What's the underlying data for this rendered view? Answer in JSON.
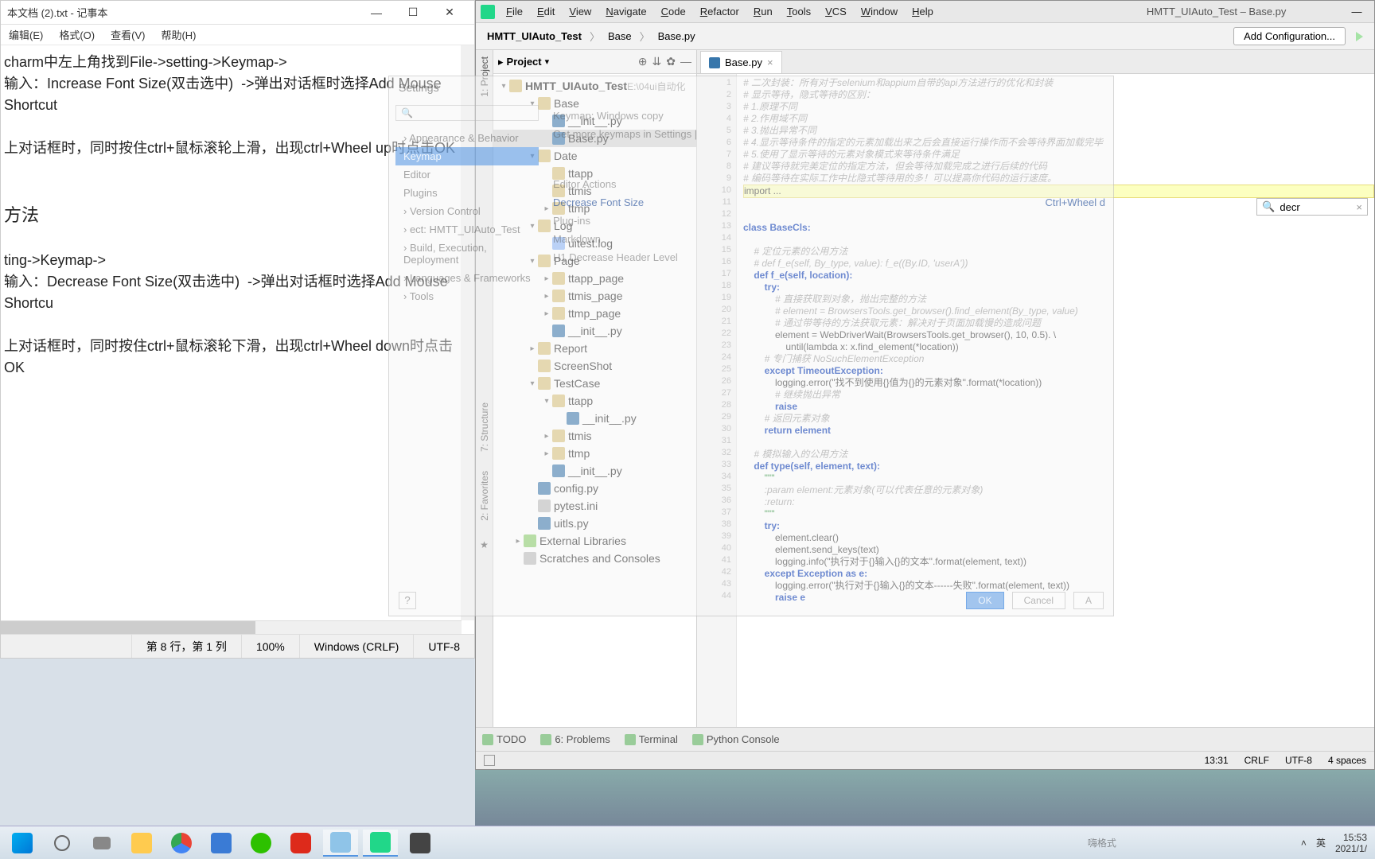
{
  "notepad": {
    "title": "本文档 (2).txt - 记事本",
    "menu": [
      "编辑(E)",
      "格式(O)",
      "查看(V)",
      "帮助(H)"
    ],
    "lines": [
      "charm中左上角找到File->setting->Keymap->",
      "输入：Increase Font Size(双击选中)  ->弹出对话框时选择Add Mouse Shortcut",
      "",
      "上对话框时，同时按住ctrl+鼠标滚轮上滑，出现ctrl+Wheel up时点击OK",
      "",
      "",
      "方法",
      "",
      "ting->Keymap->",
      "输入：Decrease Font Size(双击选中)  ->弹出对话框时选择Add Mouse Shortcu",
      "",
      "上对话框时，同时按住ctrl+鼠标滚轮下滑，出现ctrl+Wheel down时点击OK"
    ],
    "status": {
      "pos": "第 8 行，第 1 列",
      "zoom": "100%",
      "eol": "Windows (CRLF)",
      "enc": "UTF-8"
    }
  },
  "pycharm": {
    "title": "HMTT_UIAuto_Test – Base.py",
    "menu": [
      "File",
      "Edit",
      "View",
      "Navigate",
      "Code",
      "Refactor",
      "Run",
      "Tools",
      "VCS",
      "Window",
      "Help"
    ],
    "breadcrumb": [
      "HMTT_UIAuto_Test",
      "Base",
      "Base.py"
    ],
    "add_config": "Add Configuration...",
    "project": {
      "title": "Project",
      "root": "HMTT_UIAuto_Test",
      "root_path": "E:\\04ui自动化",
      "tree": [
        {
          "l": 1,
          "t": "v",
          "i": "folder",
          "n": "Base"
        },
        {
          "l": 2,
          "t": "",
          "i": "py",
          "n": "__init__.py"
        },
        {
          "l": 2,
          "t": "",
          "i": "py",
          "n": "Base.py",
          "sel": true
        },
        {
          "l": 1,
          "t": "v",
          "i": "folder",
          "n": "Date"
        },
        {
          "l": 2,
          "t": "",
          "i": "folder",
          "n": "ttapp"
        },
        {
          "l": 2,
          "t": "",
          "i": "folder",
          "n": "ttmis"
        },
        {
          "l": 2,
          "t": ">",
          "i": "folder",
          "n": "ttmp"
        },
        {
          "l": 1,
          "t": "v",
          "i": "folder",
          "n": "Log"
        },
        {
          "l": 2,
          "t": "",
          "i": "log",
          "n": "uitest.log"
        },
        {
          "l": 1,
          "t": "v",
          "i": "folder",
          "n": "Page"
        },
        {
          "l": 2,
          "t": ">",
          "i": "folder",
          "n": "ttapp_page"
        },
        {
          "l": 2,
          "t": ">",
          "i": "folder",
          "n": "ttmis_page"
        },
        {
          "l": 2,
          "t": ">",
          "i": "folder",
          "n": "ttmp_page"
        },
        {
          "l": 2,
          "t": "",
          "i": "py",
          "n": "__init__.py"
        },
        {
          "l": 1,
          "t": ">",
          "i": "folder",
          "n": "Report"
        },
        {
          "l": 1,
          "t": "",
          "i": "folder",
          "n": "ScreenShot"
        },
        {
          "l": 1,
          "t": "v",
          "i": "folder",
          "n": "TestCase"
        },
        {
          "l": 2,
          "t": "v",
          "i": "folder",
          "n": "ttapp"
        },
        {
          "l": 3,
          "t": "",
          "i": "py",
          "n": "__init__.py"
        },
        {
          "l": 2,
          "t": ">",
          "i": "folder",
          "n": "ttmis"
        },
        {
          "l": 2,
          "t": ">",
          "i": "folder",
          "n": "ttmp"
        },
        {
          "l": 2,
          "t": "",
          "i": "py",
          "n": "__init__.py"
        },
        {
          "l": 1,
          "t": "",
          "i": "py",
          "n": "config.py"
        },
        {
          "l": 1,
          "t": "",
          "i": "file",
          "n": "pytest.ini"
        },
        {
          "l": 1,
          "t": "",
          "i": "py",
          "n": "uitls.py"
        },
        {
          "l": 0,
          "t": ">",
          "i": "lib",
          "n": "External Libraries"
        },
        {
          "l": 0,
          "t": "",
          "i": "file",
          "n": "Scratches and Consoles"
        }
      ]
    },
    "tab": "Base.py",
    "search": "decr",
    "status": {
      "pos": "13:31",
      "eol": "CRLF",
      "enc": "UTF-8",
      "indent": "4 spaces"
    },
    "tool_windows": [
      "TODO",
      "6: Problems",
      "Terminal",
      "Python Console"
    ],
    "side_tools": [
      "1: Project",
      "7: Structure",
      "2: Favorites"
    ],
    "settings_ghost": {
      "title": "Settings",
      "keymap_label": "Keymap:",
      "keymap_value": "Windows copy",
      "hint": "Get more keymaps in Settings |",
      "side": [
        "Appearance & Behavior",
        "Keymap",
        "Editor",
        "Plugins",
        "Version Control",
        "ect: HMTT_UIAuto_Test",
        "Build, Execution, Deployment",
        "Languages & Frameworks",
        "Tools"
      ],
      "categories": [
        "Editor Actions",
        "Decrease Font Size",
        "Plug-ins",
        "Markdown",
        "H1 Decrease Header Level"
      ],
      "shortcut": "Ctrl+Wheel d",
      "buttons": [
        "OK",
        "Cancel",
        "A"
      ]
    },
    "code_lines": [
      {
        "n": 1,
        "c": "# 二次封装：所有对于selenium和appium自带的api方法进行的优化和封装",
        "cls": "cmt"
      },
      {
        "n": 2,
        "c": "# 显示等待，隐式等待的区别：",
        "cls": "cmt"
      },
      {
        "n": 3,
        "c": "# 1.原理不同",
        "cls": "cmt"
      },
      {
        "n": 4,
        "c": "# 2.作用域不同",
        "cls": "cmt"
      },
      {
        "n": 5,
        "c": "# 3.抛出异常不同",
        "cls": "cmt"
      },
      {
        "n": 6,
        "c": "# 4.显示等待条件的指定的元素加载出来之后会直接运行操作而不会等待界面加载完毕",
        "cls": "cmt"
      },
      {
        "n": 7,
        "c": "# 5.使用了显示等待的元素对象模式来等待条件满足",
        "cls": "cmt"
      },
      {
        "n": 8,
        "c": "# 建议等待就完美定位的指定方法，但会等待加载完成之进行后续的代码",
        "cls": "cmt"
      },
      {
        "n": 9,
        "c": "# 编码等待在实际工作中比隐式等待用的多！可以提高你代码的运行速度。",
        "cls": "cmt"
      },
      {
        "n": 10,
        "c": "import ...",
        "cls": "sel"
      },
      {
        "n": 11,
        "c": ""
      },
      {
        "n": 12,
        "c": ""
      },
      {
        "n": 13,
        "c": "class BaseCls:",
        "cls": "kw"
      },
      {
        "n": 14,
        "c": ""
      },
      {
        "n": 15,
        "c": "    # 定位元素的公用方法",
        "cls": "cmt"
      },
      {
        "n": 16,
        "c": "    # def f_e(self, By_type, value): f_e((By.ID, 'userA'))",
        "cls": "cmt"
      },
      {
        "n": 17,
        "c": "    def f_e(self, location):",
        "cls": "kw"
      },
      {
        "n": 18,
        "c": "        try:",
        "cls": "kw"
      },
      {
        "n": 19,
        "c": "            # 直接获取到对象，抛出完整的方法",
        "cls": "cmt"
      },
      {
        "n": 20,
        "c": "            # element = BrowsersTools.get_browser().find_element(By_type, value)",
        "cls": "cmt"
      },
      {
        "n": 21,
        "c": "            # 通过带等待的方法获取元素：解决对于页面加载慢的造成问题",
        "cls": "cmt"
      },
      {
        "n": 22,
        "c": "            element = WebDriverWait(BrowsersTools.get_browser(), 10, 0.5). \\"
      },
      {
        "n": 23,
        "c": "                until(lambda x: x.find_element(*location))"
      },
      {
        "n": 24,
        "c": "        # 专门捕获 NoSuchElementException",
        "cls": "cmt"
      },
      {
        "n": 25,
        "c": "        except TimeoutException:",
        "cls": "kw"
      },
      {
        "n": 26,
        "c": "            logging.error(\"找不到使用{}值为{}的元素对象\".format(*location))"
      },
      {
        "n": 27,
        "c": "            # 继续抛出异常",
        "cls": "cmt"
      },
      {
        "n": 28,
        "c": "            raise",
        "cls": "kw"
      },
      {
        "n": 29,
        "c": "        # 返回元素对象",
        "cls": "cmt"
      },
      {
        "n": 30,
        "c": "        return element",
        "cls": "kw"
      },
      {
        "n": 31,
        "c": ""
      },
      {
        "n": 32,
        "c": "    # 模拟输入的公用方法",
        "cls": "cmt"
      },
      {
        "n": 33,
        "c": "    def type(self, element, text):",
        "cls": "kw"
      },
      {
        "n": 34,
        "c": "        \"\"\"",
        "cls": "str"
      },
      {
        "n": 35,
        "c": "        :param element:元素对象(可以代表任意的元素对象)",
        "cls": "cmt"
      },
      {
        "n": 36,
        "c": "        :return:",
        "cls": "cmt"
      },
      {
        "n": 37,
        "c": "        \"\"\"",
        "cls": "str"
      },
      {
        "n": 38,
        "c": "        try:",
        "cls": "kw"
      },
      {
        "n": 39,
        "c": "            element.clear()"
      },
      {
        "n": 40,
        "c": "            element.send_keys(text)"
      },
      {
        "n": 41,
        "c": "            logging.info(\"执行对于{}输入{}的文本\".format(element, text))"
      },
      {
        "n": 42,
        "c": "        except Exception as e:",
        "cls": "kw"
      },
      {
        "n": 43,
        "c": "            logging.error(\"执行对于{}输入{}的文本------失败\".format(element, text))"
      },
      {
        "n": 44,
        "c": "            raise e",
        "cls": "kw"
      }
    ]
  },
  "taskbar": {
    "ime": "英",
    "time": "15:53",
    "date": "2021/1/",
    "watermark": "嗨格式"
  }
}
